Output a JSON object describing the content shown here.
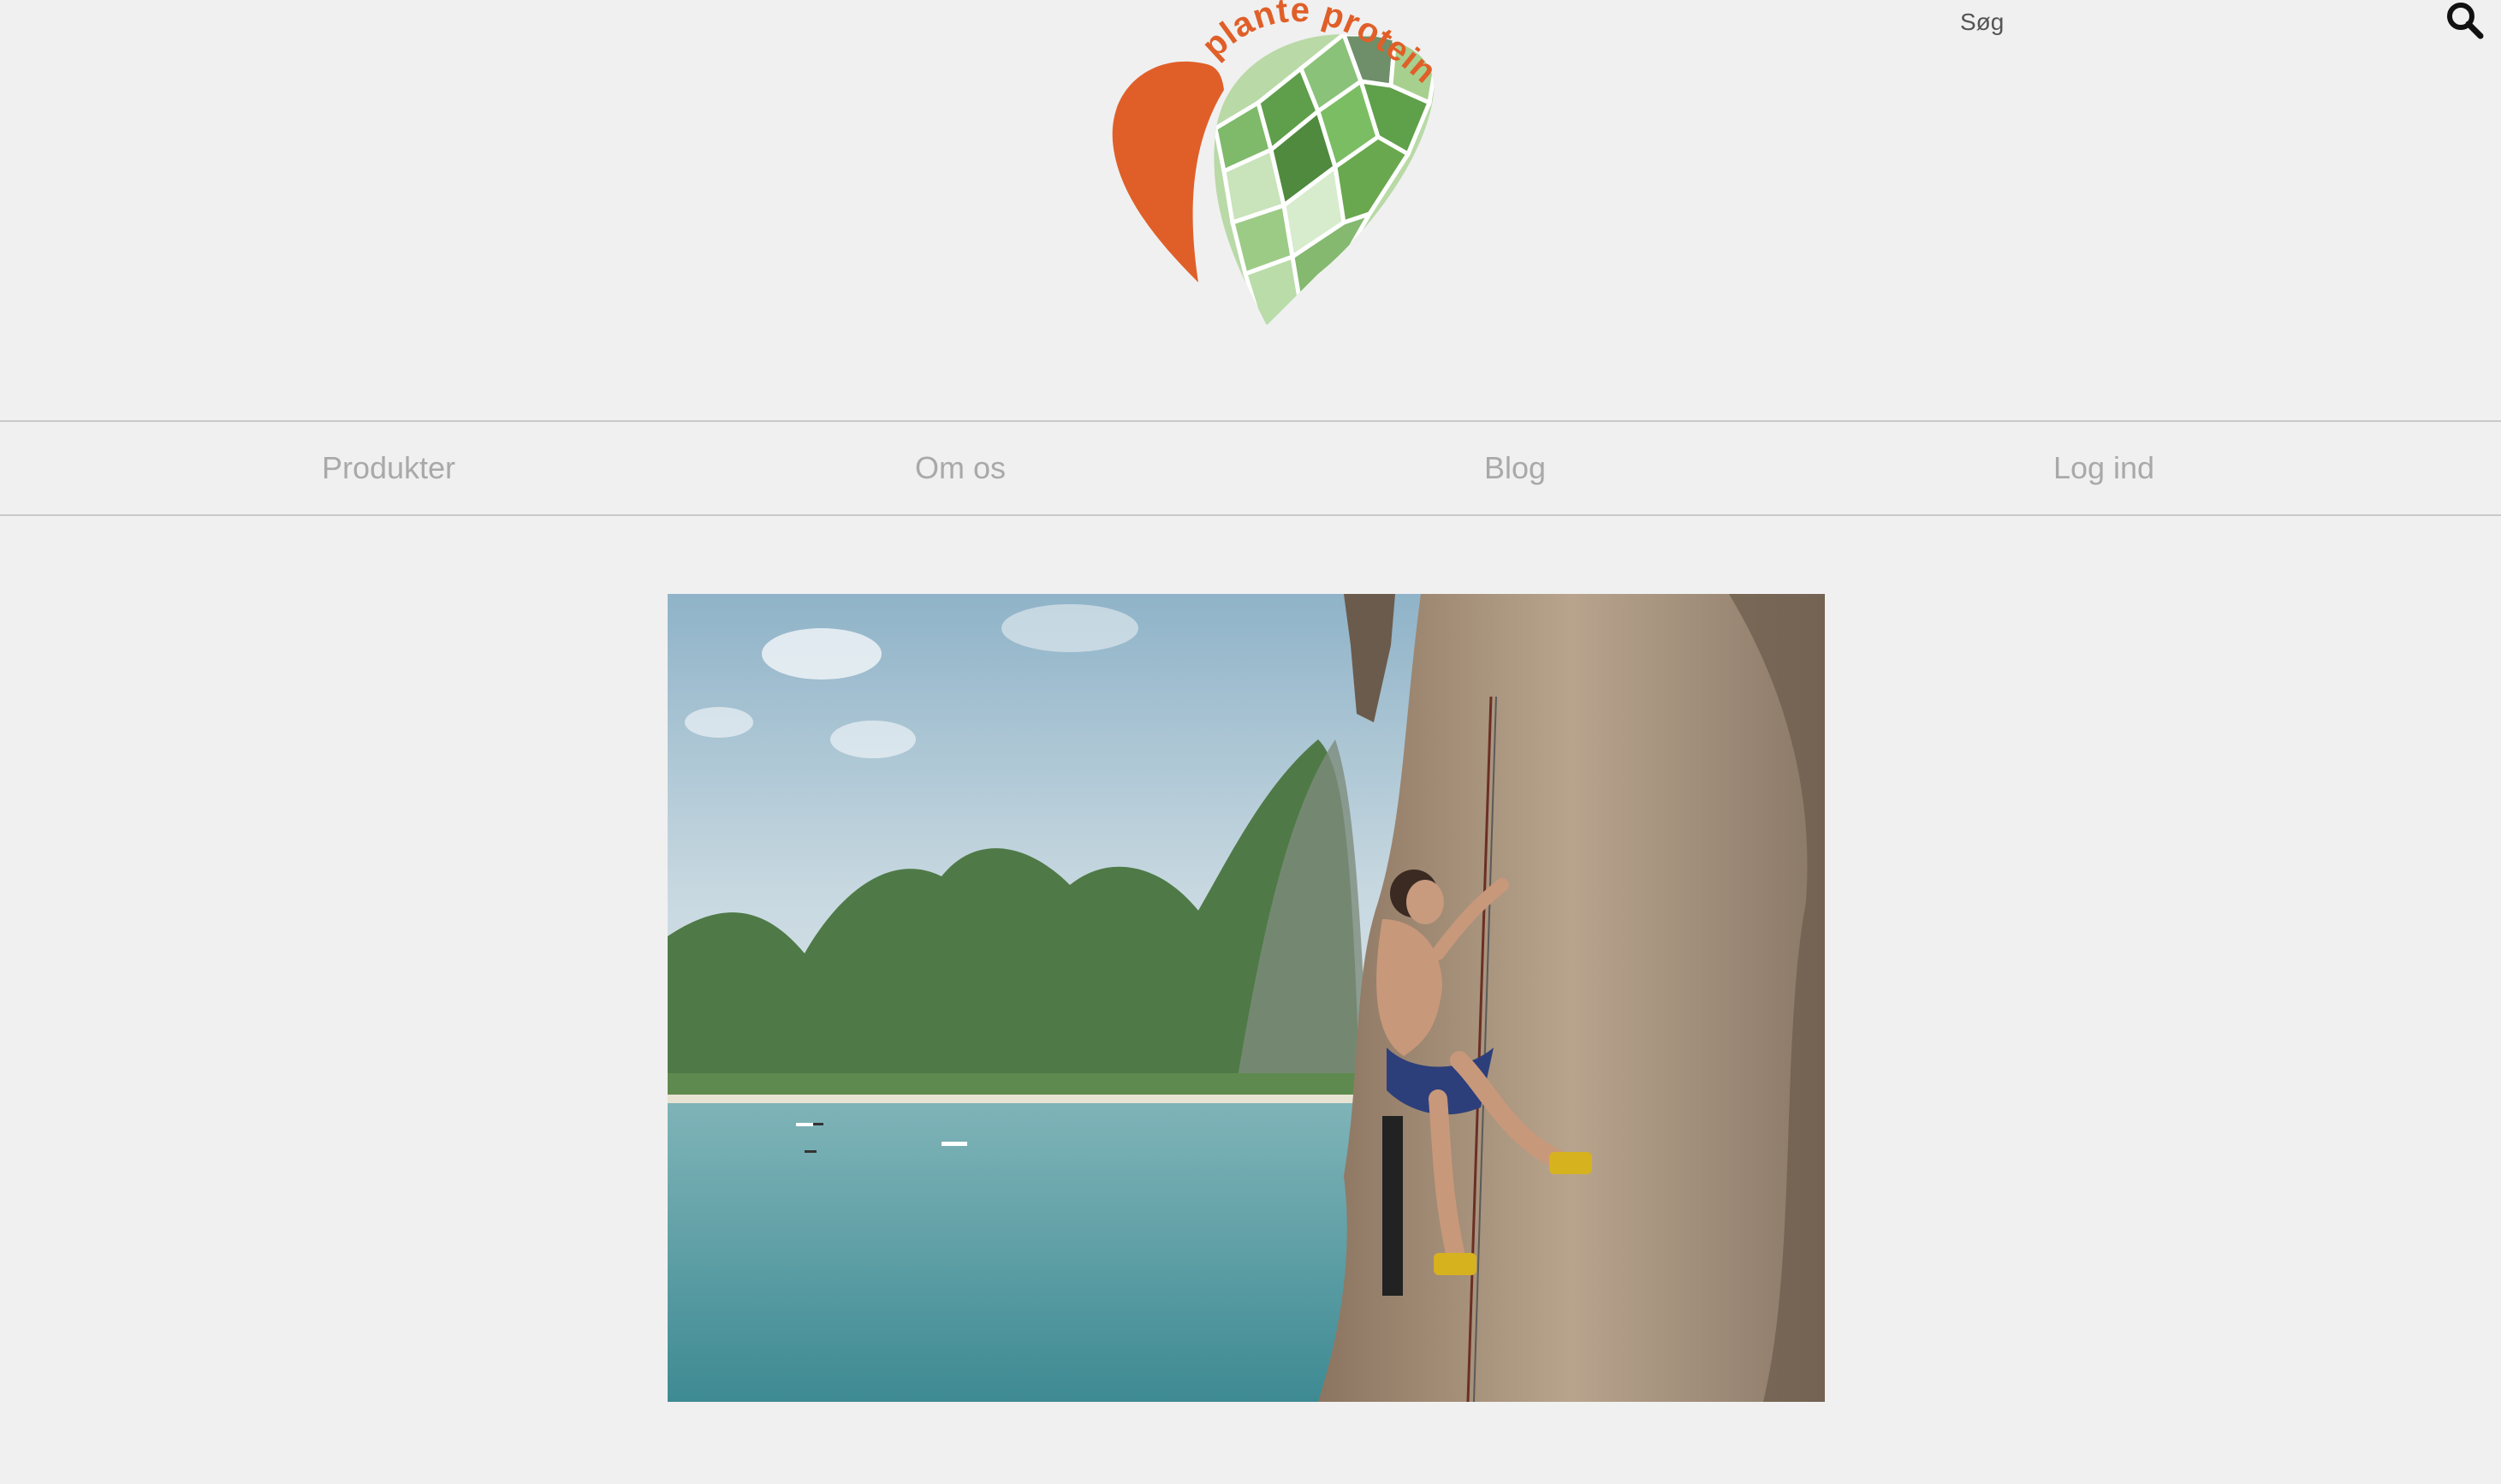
{
  "header": {
    "logo_text": "plante protein",
    "search_label": "Søg"
  },
  "nav": {
    "items": [
      {
        "label": "Produkter"
      },
      {
        "label": "Om os"
      },
      {
        "label": "Blog"
      },
      {
        "label": "Log ind"
      }
    ]
  },
  "colors": {
    "background": "#f0f0f0",
    "brand_orange": "#e05f29",
    "brand_green": "#6aa84f",
    "nav_text": "#a9a9a9",
    "divider": "#c9c9c9"
  },
  "icons": {
    "search": "search-icon",
    "logo": "leaf-heart-logo"
  }
}
